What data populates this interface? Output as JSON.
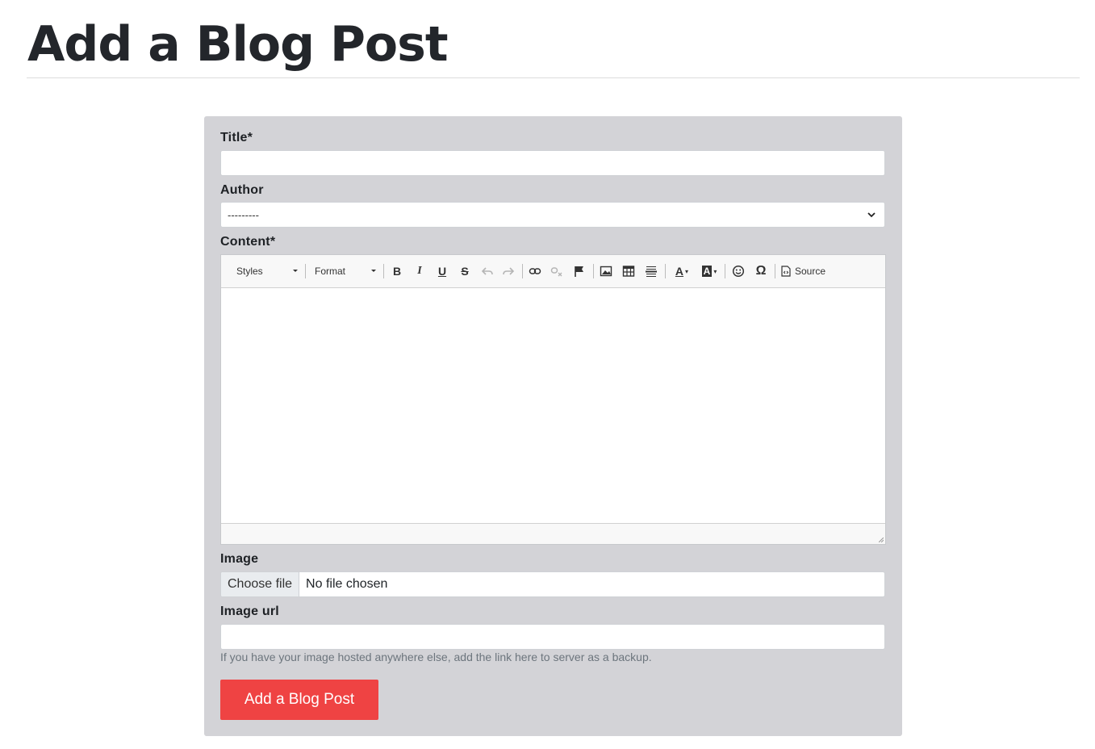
{
  "page": {
    "title": "Add a Blog Post"
  },
  "form": {
    "title_label": "Title*",
    "title_value": "",
    "author_label": "Author",
    "author_selected": "---------",
    "content_label": "Content*",
    "image_label": "Image",
    "file_button": "Choose file",
    "file_status": "No file chosen",
    "image_url_label": "Image url",
    "image_url_value": "",
    "image_url_help": "If you have your image hosted anywhere else, add the link here to server as a backup.",
    "submit_label": "Add a Blog Post"
  },
  "editor": {
    "styles_label": "Styles",
    "format_label": "Format",
    "source_label": "Source",
    "icons": [
      "bold-icon",
      "italic-icon",
      "underline-icon",
      "strikethrough-icon",
      "undo-icon",
      "redo-icon",
      "link-icon",
      "unlink-icon",
      "anchor-flag-icon",
      "image-icon",
      "table-icon",
      "horizontal-line-icon",
      "text-color-icon",
      "background-color-icon",
      "smiley-icon",
      "special-char-omega-icon",
      "source-icon"
    ]
  },
  "colors": {
    "card_bg": "#d3d3d7",
    "submit_bg": "#ef4343",
    "heading": "#23262b"
  }
}
